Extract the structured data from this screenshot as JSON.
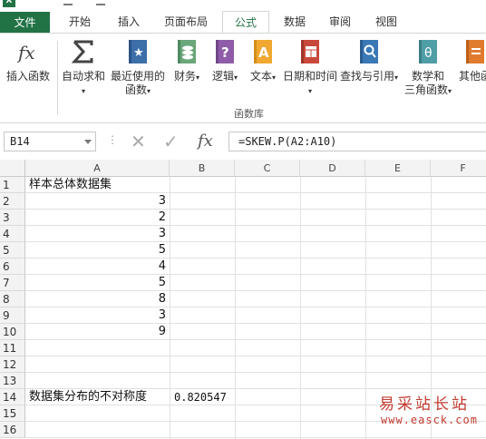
{
  "tabs": {
    "file": "文件",
    "home": "开始",
    "insert": "插入",
    "layout": "页面布局",
    "formulas": "公式",
    "data": "数据",
    "review": "审阅",
    "view": "视图"
  },
  "ribbon": {
    "insert_function": "插入函数",
    "autosum": "自动求和",
    "recent_line1": "最近使用的",
    "recent_line2": "函数",
    "financial": "财务",
    "logical": "逻辑",
    "text": "文本",
    "datetime": "日期和时间",
    "lookup": "查找与引用",
    "math_line1": "数学和",
    "math_line2": "三角函数",
    "other": "其他函",
    "group_label": "函数库",
    "icons": {
      "insert_function": "fx-icon",
      "autosum": "sigma-icon",
      "recent": "star-book-icon",
      "financial": "coins-book-icon",
      "logical": "question-book-icon",
      "text": "text-book-icon",
      "datetime": "calendar-book-icon",
      "lookup": "magnifier-book-icon",
      "math": "theta-book-icon",
      "other": "more-book-icon"
    }
  },
  "formula_bar": {
    "name_box": "B14",
    "formula": "=SKEW.P(A2:A10)",
    "fx_label": "fx"
  },
  "columns": [
    "A",
    "B",
    "C",
    "D",
    "E",
    "F"
  ],
  "rows": [
    "1",
    "2",
    "3",
    "4",
    "5",
    "6",
    "7",
    "8",
    "9",
    "10",
    "11",
    "12",
    "13",
    "14",
    "15",
    "16"
  ],
  "cells": {
    "A1": "样本总体数据集",
    "A2": "3",
    "A3": "2",
    "A4": "3",
    "A5": "5",
    "A6": "4",
    "A7": "5",
    "A8": "8",
    "A9": "3",
    "A10": "9",
    "A14": "数据集分布的不对称度",
    "B14": "0.820547"
  },
  "watermark": {
    "line1": "易采站长站",
    "line2": "www.easck.com"
  },
  "colors": {
    "excel_green": "#217346",
    "watermark_red": "#c23b2f"
  }
}
